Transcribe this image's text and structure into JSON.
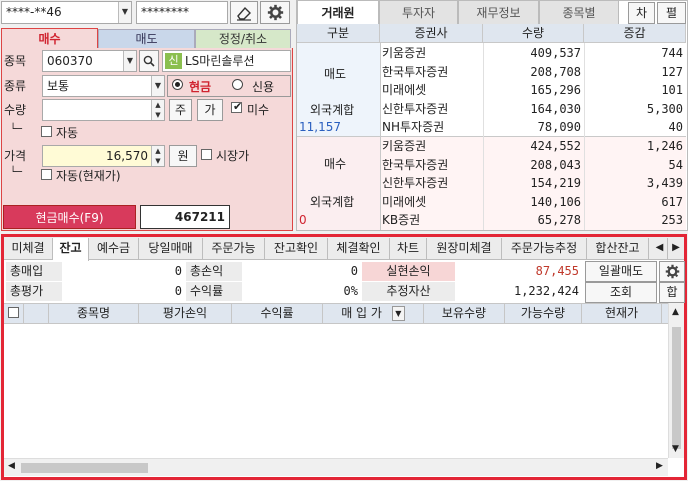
{
  "account": {
    "number": "****-**46",
    "password": "********"
  },
  "order_tabs": {
    "buy": "매수",
    "sell": "매도",
    "modify": "정정/취소"
  },
  "form": {
    "code_label": "종목",
    "code": "060370",
    "stock_badge": "신",
    "stock_name": "LS마린솔루션",
    "type_label": "종류",
    "type_value": "보통",
    "cash_label": "현금",
    "credit_label": "신용",
    "qty_label": "수량",
    "qty_value": "",
    "qty_btn1": "주",
    "qty_btn2": "가",
    "misu_label": "미수",
    "auto_label": "자동",
    "price_label": "가격",
    "price_value": "16,570",
    "price_unit": "원",
    "market_label": "시장가",
    "auto_current_label": "자동(현재가)",
    "tree_sym": "└─",
    "submit_label": "현금매수(F9)",
    "submit_value": "467211"
  },
  "broker": {
    "tabs": [
      "거래원",
      "투자자",
      "재무정보",
      "종목별"
    ],
    "side_btns": [
      "차",
      "펼"
    ],
    "headers": [
      "구분",
      "증권사",
      "수량",
      "증감"
    ],
    "sell_label": "매도",
    "buy_label": "매수",
    "foreign_label": "외국계합",
    "sell_foreign_value": "11,157",
    "buy_foreign_value": "0",
    "sell_rows": [
      {
        "name": "키움증권",
        "qty": "409,537",
        "chg": "744"
      },
      {
        "name": "한국투자증권",
        "qty": "208,708",
        "chg": "127"
      },
      {
        "name": "미래에셋",
        "qty": "165,296",
        "chg": "101"
      },
      {
        "name": "신한투자증권",
        "qty": "164,030",
        "chg": "5,300"
      },
      {
        "name": "NH투자증권",
        "qty": "78,090",
        "chg": "40"
      }
    ],
    "buy_rows": [
      {
        "name": "키움증권",
        "qty": "424,552",
        "chg": "1,246"
      },
      {
        "name": "한국투자증권",
        "qty": "208,043",
        "chg": "54"
      },
      {
        "name": "신한투자증권",
        "qty": "154,219",
        "chg": "3,439"
      },
      {
        "name": "미래에셋",
        "qty": "140,106",
        "chg": "617"
      },
      {
        "name": "KB증권",
        "qty": "65,278",
        "chg": "253"
      }
    ]
  },
  "bottom_tabs": [
    "미체결",
    "잔고",
    "예수금",
    "당일매매",
    "주문가능",
    "잔고확인",
    "체결확인",
    "차트",
    "원장미체결",
    "주문가능추정",
    "합산잔고"
  ],
  "summary": {
    "total_buy_label": "총매입",
    "total_buy": "0",
    "total_pl_label": "총손익",
    "total_pl": "0",
    "realized_label": "실현손익",
    "realized": "87,455",
    "total_eval_label": "총평가",
    "total_eval": "0",
    "return_label": "수익률",
    "return": "0%",
    "est_asset_label": "추정자산",
    "est_asset": "1,232,424",
    "bulk_sell": "일괄매도",
    "query": "조회",
    "sum_btn": "합"
  },
  "table_headers": [
    "종목명",
    "평가손익",
    "수익률",
    "매 입 가",
    "보유수량",
    "가능수량",
    "현재가"
  ],
  "colors": {
    "accent_red": "#e32636",
    "buy_pink": "#f7d8d8",
    "header_blue": "#dfe6ef",
    "submit": "#d83a5c"
  }
}
